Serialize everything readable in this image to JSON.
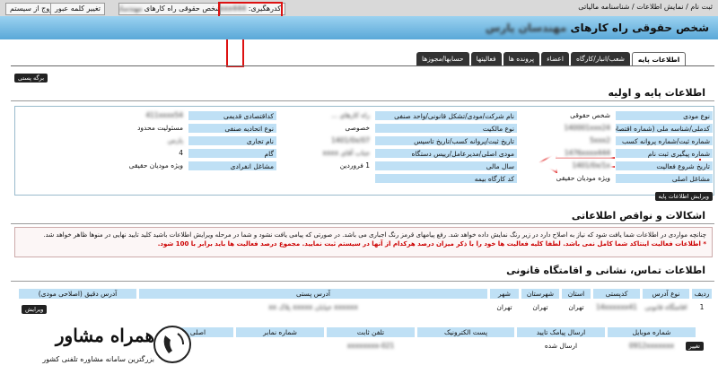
{
  "topbar": {
    "breadcrumb": "ثبت نام / نمایش اطلاعات / شناسنامه مالیاتی",
    "tracking_label": "کدرهگیری:",
    "tracking_value": "1476xxxx444",
    "type_label": "شخص حقوقی راه کارهای",
    "type_value": "مهندسان پارس",
    "change_password": "تغییر کلمه عبور",
    "logout": "خروج از سیستم"
  },
  "page": {
    "title": "شخص حقوقی راه کارهای",
    "title_blur": "مهندسان پارس"
  },
  "tabs": [
    "اطلاعات پایه",
    "شعب/انبار/کارگاه",
    "اعضاء",
    "پرونده ها",
    "فعالیتها",
    "حسابها/مجوزها"
  ],
  "buttons": {
    "print": "برگه پستی",
    "edit_basic": "ویرایش اطلاعات پایه",
    "edit_address": "ویرایش",
    "change": "تغییر"
  },
  "basic": {
    "title": "اطلاعات پایه و اولیه",
    "col1": [
      {
        "label": "نوع مودی",
        "value": "شخص حقوقی"
      },
      {
        "label": "کدملی/شناسه ملی (شماره اقتصادی)",
        "value": "140001xxx24"
      },
      {
        "label": "شماره ثبت/شماره پروانه کسب",
        "value": "5xxx2"
      },
      {
        "label": "شماره پیگیری ثبت نام",
        "value": "1476xxxx444"
      },
      {
        "label": "تاریخ شروع فعالیت",
        "value": "1401/0x/1x"
      },
      {
        "label": "مشاغل اصلی",
        "value": "ویژه مودیان حقیقی"
      }
    ],
    "col2": [
      {
        "label": "نام شرکت/مودی/تشکل قانونی/واحد صنفی",
        "value": "راه کارهای ..."
      },
      {
        "label": "نوع مالکیت",
        "value": "خصوصی"
      },
      {
        "label": "تاریخ ثبت/پروانه کسب/تاریخ تاسیس",
        "value": "1401/0x/07"
      },
      {
        "label": "مودی اصلی/مدیرعامل/رییس دستگاه",
        "value": "جناب آقای xxxx"
      },
      {
        "label": "سال مالی",
        "value": "1 فروردین"
      },
      {
        "label": "کد کارگاه بیمه",
        "value": ""
      }
    ],
    "col3": [
      {
        "label": "کداقتصادی قدیمی",
        "value": "411xxxx54"
      },
      {
        "label": "نوع اتحادیه صنفی",
        "value": "مسئولیت محدود"
      },
      {
        "label": "نام تجاری",
        "value": "پارس"
      },
      {
        "label": "گام",
        "value": "4"
      },
      {
        "label": "مشاغل انفرادی",
        "value": "ویژه مودیان حقیقی"
      }
    ]
  },
  "issues": {
    "title": "اشکالات و نواقص اطلاعاتی",
    "line1": "چنانچه مواردی در اطلاعات شما یافت شود که نیاز به اصلاح دارد در زیر رنگ نمایش داده خواهد شد. رفع پیامهای قرمز رنگ اجباری می باشد. در صورتی که پیامی یافت نشود و شما در مرحله ویرایش اطلاعات باشید کلید تایید نهایی در منوها ظاهر خواهد شد.",
    "line2": "* اطلاعات فعالیت اینتاکد شما کامل نمی باشد. لطفا کلیه فعالیت ها خود را با ذکر میزان درصد هرکدام از آنها در سیستم ثبت نمایید. مجموع درصد فعالیت ها باید برابر با 100 شود."
  },
  "contact": {
    "title": "اطلاعات تماس، نشانی و اقامتگاه قانونی",
    "headers": [
      "ردیف",
      "نوع آدرس",
      "کدپستی",
      "استان",
      "شهرستان",
      "شهر",
      "آدرس پستی",
      "آدرس دقیق (اصلاحی مودی)"
    ],
    "row": [
      "1",
      "اقامتگاه قانونی",
      "14xxxxxx41",
      "تهران",
      "تهران",
      "تهران",
      "xxxxxx خیابان xxxxx پلاک xx",
      ""
    ],
    "sub_headers": [
      "شماره موبایل",
      "ارسال پیامک تایید",
      "پست الکترونیک",
      "تلفن ثابت",
      "شماره نمابر",
      "اصلی"
    ],
    "sub_row": [
      "0912xxxxxxx",
      "ارسال شده",
      "",
      "021-xxxxxxxx",
      "",
      ""
    ]
  },
  "watermark": {
    "brand": "همراه مشاور",
    "tagline": "بزرگترین سامانه مشاوره تلفنی کشور"
  }
}
